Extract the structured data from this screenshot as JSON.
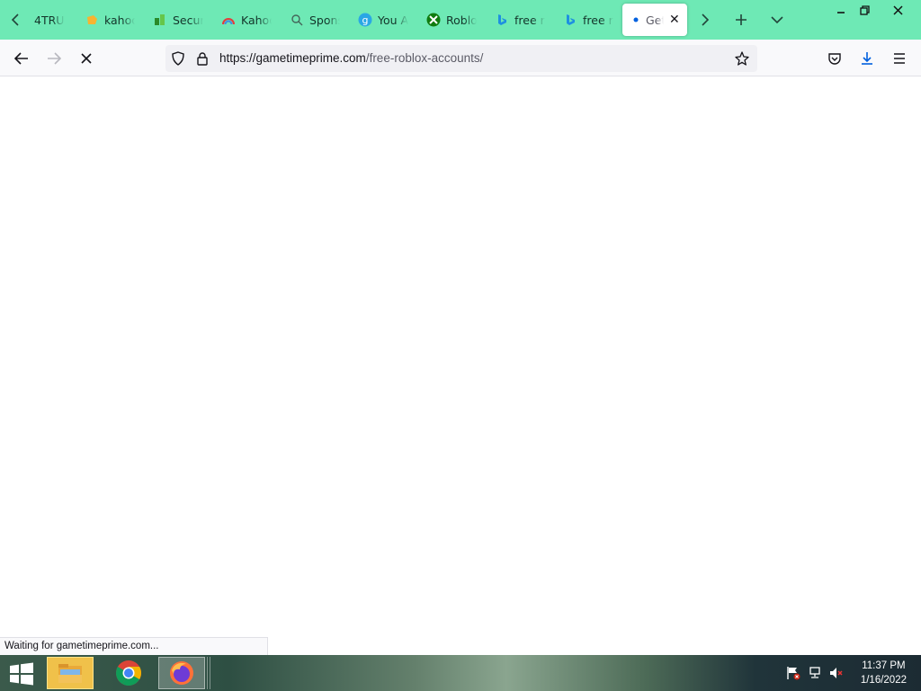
{
  "tabs": [
    {
      "title": "4TRU",
      "icon": "none"
    },
    {
      "title": "kahoo",
      "icon": "kahoot-tag-icon"
    },
    {
      "title": "Secur",
      "icon": "security-icon"
    },
    {
      "title": "Kahoo",
      "icon": "rainbow-icon"
    },
    {
      "title": "Spons",
      "icon": "search-icon"
    },
    {
      "title": "You A",
      "icon": "g-icon"
    },
    {
      "title": "Roblo",
      "icon": "xbox-icon"
    },
    {
      "title": "free ro",
      "icon": "bing-icon"
    },
    {
      "title": "free ro",
      "icon": "bing-icon"
    },
    {
      "title": "Get",
      "icon": "loading-dot-icon",
      "active": true
    }
  ],
  "url": {
    "domain": "https://gametimeprime.com",
    "path": "/free-roblox-accounts/"
  },
  "status_text": "Waiting for gametimeprime.com...",
  "clock": {
    "time": "11:37 PM",
    "date": "1/16/2022"
  },
  "colors": {
    "tabbar": "#6ee9b5",
    "accent": "#0060df"
  }
}
